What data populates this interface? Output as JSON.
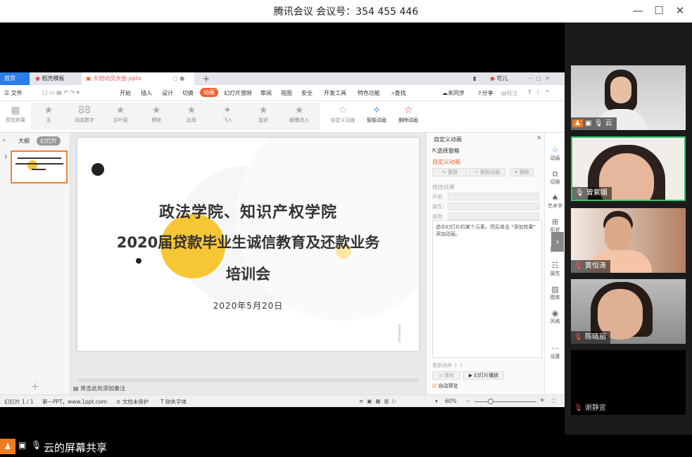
{
  "window": {
    "title": "腾讯会议 会议号：354 455 446",
    "controls": [
      "—",
      "☐",
      "✕"
    ]
  },
  "wps": {
    "tabs": [
      {
        "label": "首页"
      },
      {
        "label": "稻壳模板"
      },
      {
        "label": "大创动员大会.pptx"
      }
    ],
    "user": "可儿",
    "menu": [
      "文件",
      "开始",
      "插入",
      "设计",
      "切换",
      "动画",
      "幻灯片放映",
      "审阅",
      "视图",
      "安全",
      "开发工具",
      "特色功能"
    ],
    "search": "查找",
    "sync": "未同步",
    "share": "分享",
    "comment": "批注",
    "ribbon": [
      "预览效果",
      "无",
      "动态数字",
      "百叶窗",
      "擦除",
      "出现",
      "飞入",
      "盒状",
      "缓慢进入",
      "自定义动画",
      "智能动画",
      "删除动画"
    ],
    "left_tabs": [
      "大纲",
      "幻灯片"
    ],
    "thumb_num": "1",
    "slide": {
      "line1": "政法学院、知识产权学院",
      "line2": "2020届贷款毕业生诚信教育及还款业务",
      "line3": "培训会",
      "date": "2020年5月20日"
    },
    "notes": "单击此处添加备注",
    "pane": {
      "title": "自定义动画",
      "select": "选择窗格",
      "heading": "自定义动画",
      "btn_change": "更改",
      "btn_smart": "智能动画",
      "btn_delete": "删除",
      "modify": "修改效果",
      "start": "开始:",
      "prop": "属性:",
      "speed": "速度:",
      "hint": "选中幻灯片的某个元素，然后单击 \"添加效果\" 添加动画。",
      "reorder": "重新排序",
      "play": "播放",
      "slideshow": "幻灯片播放",
      "autopreview": "自动预览"
    },
    "vtools": [
      "动画",
      "切换",
      "艺术字",
      "形状",
      "图片",
      "属性",
      "图库",
      "风格",
      "设置"
    ],
    "status": {
      "slide": "幻灯片 1 / 1",
      "theme": "第一PPT，www.1ppt.com",
      "protect": "文档未保护",
      "font": "缺失字体",
      "zoom": "60%"
    }
  },
  "participants": [
    {
      "name": "云"
    },
    {
      "name": "曾紫媚"
    },
    {
      "name": "黄恒涛"
    },
    {
      "name": "陈晓丽"
    },
    {
      "name": "谢静宜"
    }
  ],
  "bottom_bar": {
    "label": "云的屏幕共享"
  },
  "colors": {
    "accent": "#f0622e",
    "wps_blue": "#2b7de9",
    "slide_yellow": "#f7c634",
    "tencent_orange": "#f07c22"
  }
}
